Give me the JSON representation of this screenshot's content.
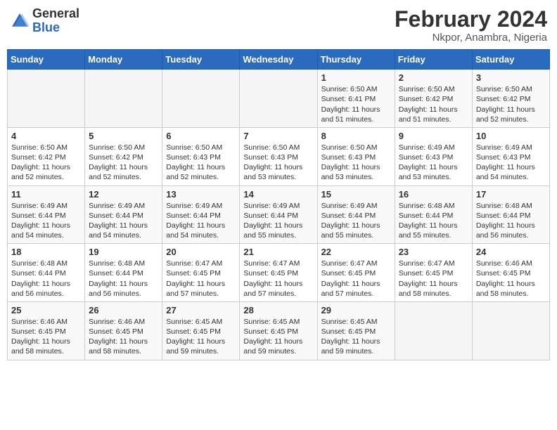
{
  "header": {
    "logo_general": "General",
    "logo_blue": "Blue",
    "title": "February 2024",
    "subtitle": "Nkpor, Anambra, Nigeria"
  },
  "weekdays": [
    "Sunday",
    "Monday",
    "Tuesday",
    "Wednesday",
    "Thursday",
    "Friday",
    "Saturday"
  ],
  "weeks": [
    [
      {
        "day": "",
        "info": ""
      },
      {
        "day": "",
        "info": ""
      },
      {
        "day": "",
        "info": ""
      },
      {
        "day": "",
        "info": ""
      },
      {
        "day": "1",
        "info": "Sunrise: 6:50 AM\nSunset: 6:41 PM\nDaylight: 11 hours\nand 51 minutes."
      },
      {
        "day": "2",
        "info": "Sunrise: 6:50 AM\nSunset: 6:42 PM\nDaylight: 11 hours\nand 51 minutes."
      },
      {
        "day": "3",
        "info": "Sunrise: 6:50 AM\nSunset: 6:42 PM\nDaylight: 11 hours\nand 52 minutes."
      }
    ],
    [
      {
        "day": "4",
        "info": "Sunrise: 6:50 AM\nSunset: 6:42 PM\nDaylight: 11 hours\nand 52 minutes."
      },
      {
        "day": "5",
        "info": "Sunrise: 6:50 AM\nSunset: 6:42 PM\nDaylight: 11 hours\nand 52 minutes."
      },
      {
        "day": "6",
        "info": "Sunrise: 6:50 AM\nSunset: 6:43 PM\nDaylight: 11 hours\nand 52 minutes."
      },
      {
        "day": "7",
        "info": "Sunrise: 6:50 AM\nSunset: 6:43 PM\nDaylight: 11 hours\nand 53 minutes."
      },
      {
        "day": "8",
        "info": "Sunrise: 6:50 AM\nSunset: 6:43 PM\nDaylight: 11 hours\nand 53 minutes."
      },
      {
        "day": "9",
        "info": "Sunrise: 6:49 AM\nSunset: 6:43 PM\nDaylight: 11 hours\nand 53 minutes."
      },
      {
        "day": "10",
        "info": "Sunrise: 6:49 AM\nSunset: 6:43 PM\nDaylight: 11 hours\nand 54 minutes."
      }
    ],
    [
      {
        "day": "11",
        "info": "Sunrise: 6:49 AM\nSunset: 6:44 PM\nDaylight: 11 hours\nand 54 minutes."
      },
      {
        "day": "12",
        "info": "Sunrise: 6:49 AM\nSunset: 6:44 PM\nDaylight: 11 hours\nand 54 minutes."
      },
      {
        "day": "13",
        "info": "Sunrise: 6:49 AM\nSunset: 6:44 PM\nDaylight: 11 hours\nand 54 minutes."
      },
      {
        "day": "14",
        "info": "Sunrise: 6:49 AM\nSunset: 6:44 PM\nDaylight: 11 hours\nand 55 minutes."
      },
      {
        "day": "15",
        "info": "Sunrise: 6:49 AM\nSunset: 6:44 PM\nDaylight: 11 hours\nand 55 minutes."
      },
      {
        "day": "16",
        "info": "Sunrise: 6:48 AM\nSunset: 6:44 PM\nDaylight: 11 hours\nand 55 minutes."
      },
      {
        "day": "17",
        "info": "Sunrise: 6:48 AM\nSunset: 6:44 PM\nDaylight: 11 hours\nand 56 minutes."
      }
    ],
    [
      {
        "day": "18",
        "info": "Sunrise: 6:48 AM\nSunset: 6:44 PM\nDaylight: 11 hours\nand 56 minutes."
      },
      {
        "day": "19",
        "info": "Sunrise: 6:48 AM\nSunset: 6:44 PM\nDaylight: 11 hours\nand 56 minutes."
      },
      {
        "day": "20",
        "info": "Sunrise: 6:47 AM\nSunset: 6:45 PM\nDaylight: 11 hours\nand 57 minutes."
      },
      {
        "day": "21",
        "info": "Sunrise: 6:47 AM\nSunset: 6:45 PM\nDaylight: 11 hours\nand 57 minutes."
      },
      {
        "day": "22",
        "info": "Sunrise: 6:47 AM\nSunset: 6:45 PM\nDaylight: 11 hours\nand 57 minutes."
      },
      {
        "day": "23",
        "info": "Sunrise: 6:47 AM\nSunset: 6:45 PM\nDaylight: 11 hours\nand 58 minutes."
      },
      {
        "day": "24",
        "info": "Sunrise: 6:46 AM\nSunset: 6:45 PM\nDaylight: 11 hours\nand 58 minutes."
      }
    ],
    [
      {
        "day": "25",
        "info": "Sunrise: 6:46 AM\nSunset: 6:45 PM\nDaylight: 11 hours\nand 58 minutes."
      },
      {
        "day": "26",
        "info": "Sunrise: 6:46 AM\nSunset: 6:45 PM\nDaylight: 11 hours\nand 58 minutes."
      },
      {
        "day": "27",
        "info": "Sunrise: 6:45 AM\nSunset: 6:45 PM\nDaylight: 11 hours\nand 59 minutes."
      },
      {
        "day": "28",
        "info": "Sunrise: 6:45 AM\nSunset: 6:45 PM\nDaylight: 11 hours\nand 59 minutes."
      },
      {
        "day": "29",
        "info": "Sunrise: 6:45 AM\nSunset: 6:45 PM\nDaylight: 11 hours\nand 59 minutes."
      },
      {
        "day": "",
        "info": ""
      },
      {
        "day": "",
        "info": ""
      }
    ]
  ]
}
